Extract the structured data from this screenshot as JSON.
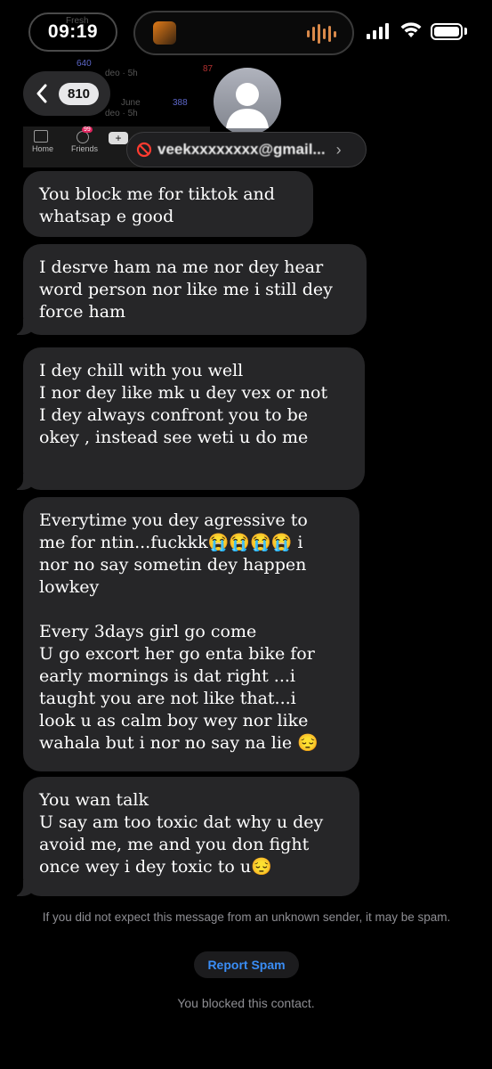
{
  "status_bar": {
    "time": "09:19",
    "battery_level": 1.0
  },
  "background_app": {
    "label_fresh": "Fresh",
    "label_video_1": "deo · 5h",
    "label_june": "June",
    "label_video_2": "deo · 5h",
    "count_640": "640",
    "count_388": "388",
    "badge_87": "87",
    "badge_99": "99",
    "tab_home": "Home",
    "tab_friends": "Friends"
  },
  "header": {
    "back_count": "810",
    "contact_name": "veekxxxxxxxx@gmail..."
  },
  "messages": [
    {
      "text": "You block me for tiktok and\nwhatsap e good"
    },
    {
      "text": "I desrve ham na me nor dey hear\nword person nor like me i still dey\nforce ham"
    },
    {
      "text": "I dey chill with you well\nI nor dey like mk u dey vex or not\nI dey always confront you to be\nokey , instead see weti u do me"
    },
    {
      "text": "Everytime you dey agressive to\nme for ntin...fuckkk😭😭😭😭 i\nnor no say sometin dey happen\nlowkey\n\nEvery 3days girl go come\nU go excort her go enta bike for\nearly mornings is dat right ...i\ntaught you are not like that...i\nlook u as calm boy wey nor like\nwahala but i nor no say na lie 😔"
    },
    {
      "text": "You wan talk\nU say am too toxic dat why u dey\navoid me, me and you don fight\nonce wey i dey toxic to u😔"
    }
  ],
  "footer": {
    "notice": "If you did not expect this message from an unknown sender, it may be spam.",
    "report_spam": "Report Spam",
    "blocked_text": "You blocked this contact."
  },
  "colors": {
    "background": "#000000",
    "bubble": "#262628",
    "link": "#3a8df5",
    "muted_text": "#8e8e93"
  }
}
